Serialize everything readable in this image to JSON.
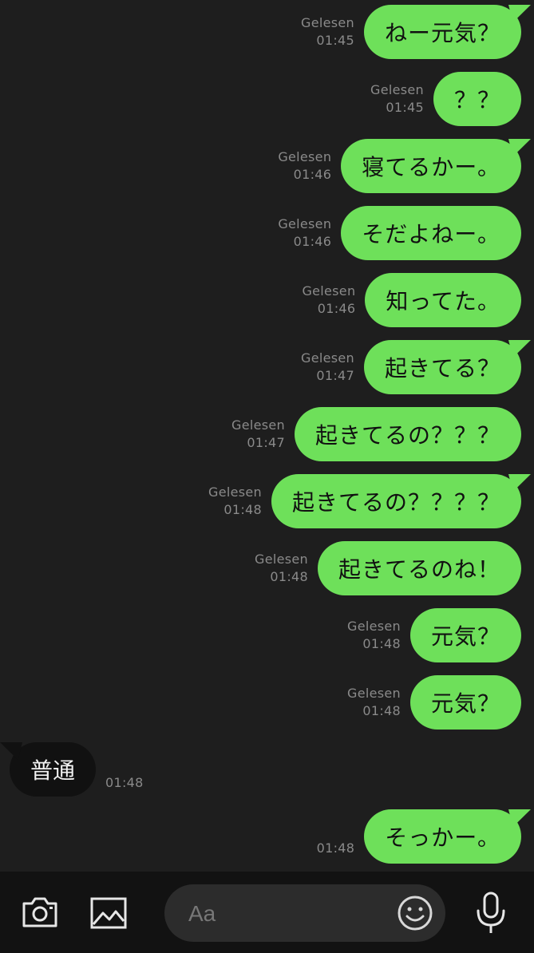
{
  "outgoing": [
    {
      "text": "ねー元気？",
      "read": "Gelesen",
      "time": "01:45",
      "tail": true
    },
    {
      "text": "？？",
      "read": "Gelesen",
      "time": "01:45",
      "tail": false
    },
    {
      "text": "寝てるかー。",
      "read": "Gelesen",
      "time": "01:46",
      "tail": true
    },
    {
      "text": "そだよねー。",
      "read": "Gelesen",
      "time": "01:46",
      "tail": false
    },
    {
      "text": "知ってた。",
      "read": "Gelesen",
      "time": "01:46",
      "tail": false
    },
    {
      "text": "起きてる？",
      "read": "Gelesen",
      "time": "01:47",
      "tail": true
    },
    {
      "text": "起きてるの？？？",
      "read": "Gelesen",
      "time": "01:47",
      "tail": false
    },
    {
      "text": "起きてるの？？？？",
      "read": "Gelesen",
      "time": "01:48",
      "tail": true
    },
    {
      "text": "起きてるのね！",
      "read": "Gelesen",
      "time": "01:48",
      "tail": false
    },
    {
      "text": "元気？",
      "read": "Gelesen",
      "time": "01:48",
      "tail": false
    },
    {
      "text": "元気？",
      "read": "Gelesen",
      "time": "01:48",
      "tail": false
    }
  ],
  "incoming": {
    "text": "普通",
    "time": "01:48"
  },
  "last_outgoing": {
    "text": "そっかー。",
    "time": "01:48"
  },
  "toolbar": {
    "input_placeholder": "Aa",
    "icons": [
      "camera-icon",
      "image-icon",
      "emoji-icon",
      "microphone-icon"
    ]
  },
  "colors": {
    "background": "#1e1e1e",
    "outgoing_bubble": "#6ee05a",
    "incoming_bubble": "#111111",
    "meta_text": "#8a8a8a",
    "toolbar": "#121212"
  }
}
